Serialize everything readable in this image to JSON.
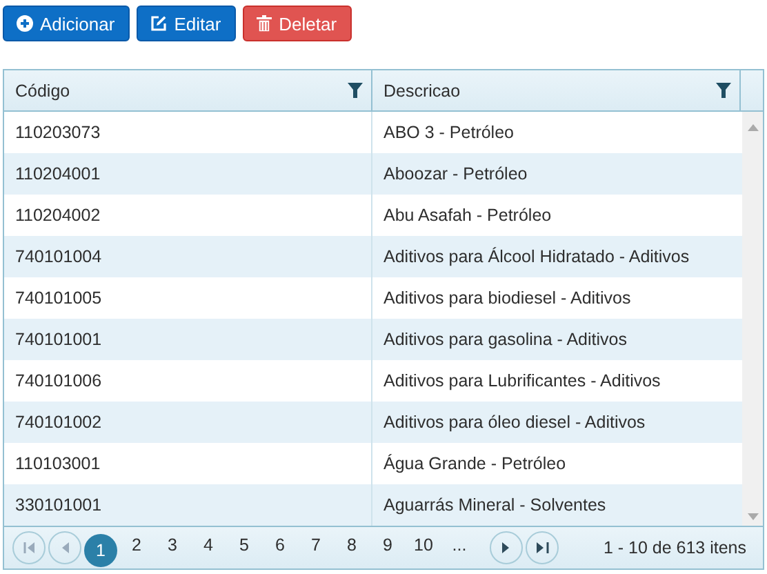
{
  "toolbar": [
    {
      "label": "Adicionar",
      "kind": "add"
    },
    {
      "label": "Editar",
      "kind": "edit"
    },
    {
      "label": "Deletar",
      "kind": "delete"
    }
  ],
  "table": {
    "columns": [
      "Código",
      "Descricao"
    ],
    "rows": [
      [
        "110203073",
        "ABO 3 - Petróleo"
      ],
      [
        "110204001",
        "Aboozar - Petróleo"
      ],
      [
        "110204002",
        "Abu Asafah - Petróleo"
      ],
      [
        "740101004",
        "Aditivos para Álcool Hidratado - Aditivos"
      ],
      [
        "740101005",
        "Aditivos para biodiesel - Aditivos"
      ],
      [
        "740101001",
        "Aditivos para gasolina - Aditivos"
      ],
      [
        "740101006",
        "Aditivos para Lubrificantes - Aditivos"
      ],
      [
        "740101002",
        "Aditivos para óleo diesel - Aditivos"
      ],
      [
        "110103001",
        "Água Grande - Petróleo"
      ],
      [
        "330101001",
        "Aguarrás Mineral - Solventes"
      ]
    ]
  },
  "pager": {
    "first_disabled": true,
    "prev_disabled": true,
    "pages": [
      {
        "label": "1",
        "selected": true
      },
      {
        "label": "2",
        "selected": false
      },
      {
        "label": "3",
        "selected": false
      },
      {
        "label": "4",
        "selected": false
      },
      {
        "label": "5",
        "selected": false
      },
      {
        "label": "6",
        "selected": false
      },
      {
        "label": "7",
        "selected": false
      },
      {
        "label": "8",
        "selected": false
      },
      {
        "label": "9",
        "selected": false
      },
      {
        "label": "10",
        "selected": false
      },
      {
        "label": "...",
        "selected": false
      }
    ],
    "info": "1 - 10 de 613 itens"
  }
}
